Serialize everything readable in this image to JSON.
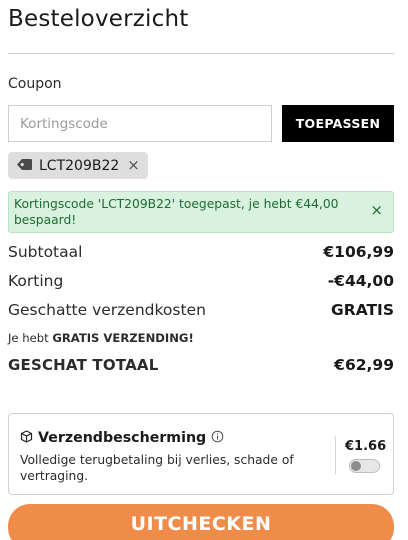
{
  "header": {
    "title": "Besteloverzicht"
  },
  "coupon": {
    "label": "Coupon",
    "placeholder": "Kortingscode",
    "apply_label": "TOEPASSEN",
    "applied_code": "LCT209B22",
    "chip_close": "×",
    "tag_icon": "tag-icon"
  },
  "notice": {
    "message": "Kortingscode 'LCT209B22' toegepast, je hebt €44,00 bespaard!",
    "close": "×",
    "color": "#1e6b31"
  },
  "summary": {
    "subtotal_label": "Subtotaal",
    "subtotal_value": "€106,99",
    "discount_label": "Korting",
    "discount_value": "-€44,00",
    "shipping_label": "Geschatte verzendkosten",
    "shipping_value": "GRATIS",
    "free_note_prefix": "Je hebt",
    "free_note_bold": "GRATIS VERZENDING!",
    "total_label": "GESCHAT TOTAAL",
    "total_value": "€62,99"
  },
  "protection": {
    "title": "Verzendbescherming",
    "description": "Volledige terugbetaling bij verlies, schade of vertraging.",
    "price": "€1.66",
    "enabled": false,
    "box_icon": "package-icon",
    "info_icon": "info-icon"
  },
  "checkout": {
    "label": "UITCHECKEN",
    "color": "#ef8c49"
  }
}
